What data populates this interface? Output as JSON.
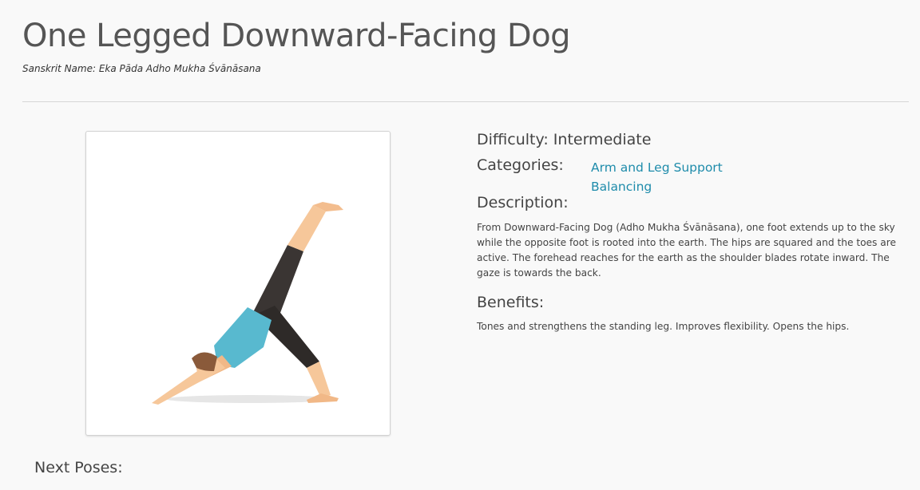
{
  "pose": {
    "title": "One Legged Downward-Facing Dog",
    "sanskrit": "Sanskrit Name: Eka Pāda Adho Mukha Śvānāsana"
  },
  "details": {
    "difficulty": "Difficulty: Intermediate",
    "categories_label": "Categories:",
    "categories": [
      "Arm and Leg Support",
      "Balancing"
    ],
    "description_label": "Description:",
    "description": "From Downward-Facing Dog (Adho Mukha Śvānāsana), one foot extends up to the sky while the opposite foot is rooted into the earth. The hips are squared and the toes are active. The forehead reaches for the earth as the shoulder blades rotate inward. The gaze is towards the back.",
    "benefits_label": "Benefits:",
    "benefits": "Tones and strengthens the standing leg. Improves flexibility. Opens the hips."
  },
  "footer": {
    "next_poses_label": "Next Poses:"
  },
  "colors": {
    "link": "#1f8cab",
    "skin": "#f6c79a",
    "top": "#58b9cf",
    "pants": "#3a3533",
    "hair": "#8a5a3a"
  }
}
